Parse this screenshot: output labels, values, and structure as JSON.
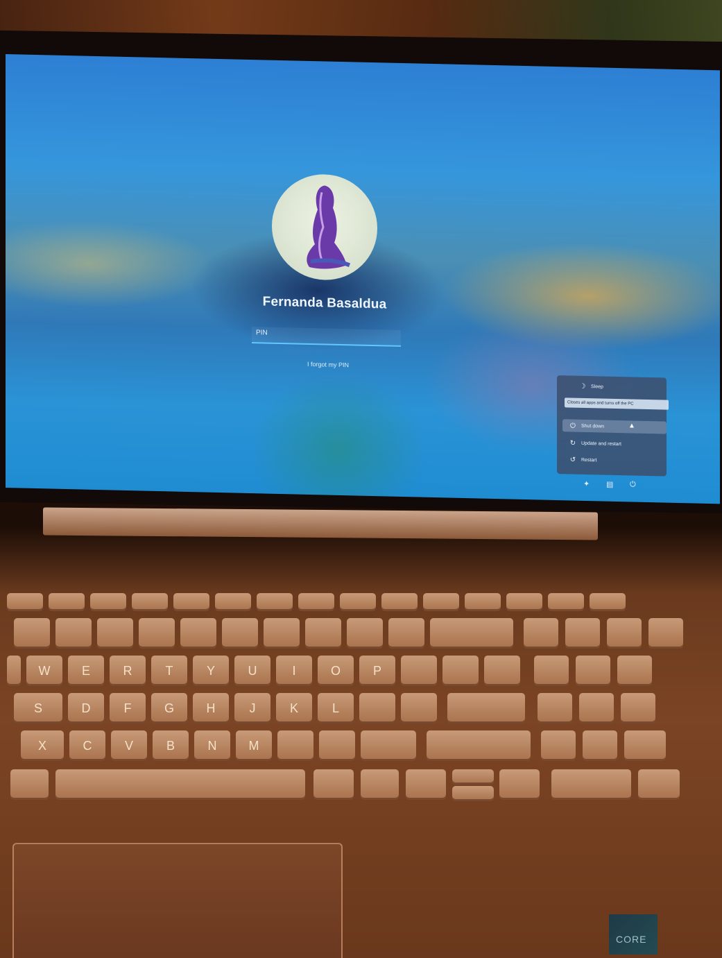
{
  "lock_screen": {
    "username": "Fernanda Basaldua",
    "pin_placeholder": "PIN",
    "forgot_link": "I forgot my PIN"
  },
  "power_menu": {
    "items": [
      {
        "label": "Sleep",
        "icon": "moon-icon"
      },
      {
        "label": "Shut down",
        "icon": "power-icon"
      },
      {
        "label": "Update and restart",
        "icon": "update-icon"
      },
      {
        "label": "Restart",
        "icon": "restart-icon"
      }
    ],
    "tooltip": "Closes all apps and turns off the PC"
  },
  "tray_icons": [
    "accessibility-icon",
    "network-icon",
    "power-icon"
  ],
  "keyboard": {
    "row1": [
      "W",
      "E",
      "R",
      "T",
      "Y",
      "U",
      "I",
      "O",
      "P"
    ],
    "row2": [
      "S",
      "D",
      "F",
      "G",
      "H",
      "J",
      "K",
      "L"
    ],
    "row3": [
      "X",
      "C",
      "V",
      "B",
      "N",
      "M"
    ]
  },
  "sticker_text": "CORE"
}
